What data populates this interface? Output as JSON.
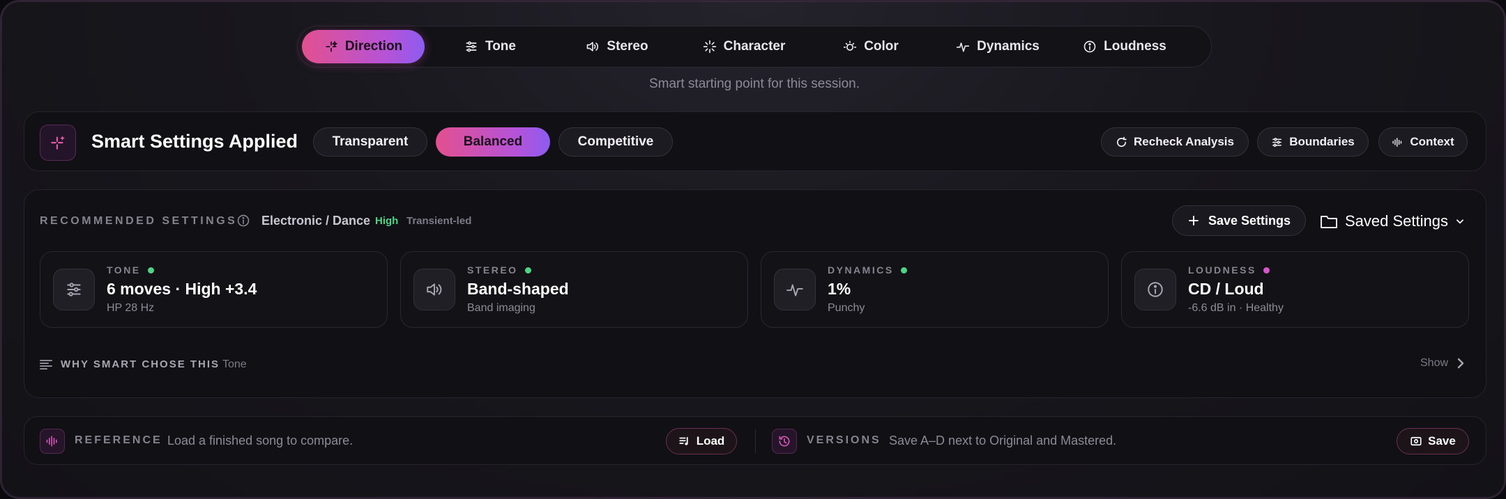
{
  "tabs": [
    {
      "label": "Direction",
      "icon": "sparkle-icon",
      "active": true
    },
    {
      "label": "Tone",
      "icon": "sliders-icon"
    },
    {
      "label": "Stereo",
      "icon": "speaker-icon"
    },
    {
      "label": "Character",
      "icon": "starburst-icon"
    },
    {
      "label": "Color",
      "icon": "sun-icon"
    },
    {
      "label": "Dynamics",
      "icon": "pulse-icon"
    },
    {
      "label": "Loudness",
      "icon": "gauge-icon"
    }
  ],
  "subtitle": "Smart starting point for this session.",
  "smart": {
    "title": "Smart Settings Applied",
    "modes": [
      "Transparent",
      "Balanced",
      "Competitive"
    ],
    "active_mode": "Balanced",
    "actions": {
      "recheck": "Recheck Analysis",
      "boundaries": "Boundaries",
      "context": "Context"
    }
  },
  "recommended": {
    "label": "RECOMMENDED SETTINGS",
    "genre": "Electronic / Dance",
    "confidence": "High",
    "character": "Transient-led",
    "save_label": "Save Settings",
    "saved_label": "Saved Settings",
    "cards": [
      {
        "category": "TONE",
        "value": "6 moves · High +3.4",
        "sub": "HP 28 Hz",
        "dot": "#4fd486",
        "icon": "sliders-icon"
      },
      {
        "category": "STEREO",
        "value": "Band-shaped",
        "sub": "Band imaging",
        "dot": "#4fd486",
        "icon": "speaker-icon"
      },
      {
        "category": "DYNAMICS",
        "value": "1%",
        "sub": "Punchy",
        "dot": "#4fd486",
        "icon": "pulse-icon"
      },
      {
        "category": "LOUDNESS",
        "value": "CD / Loud",
        "sub": "-6.6 dB in · Healthy",
        "dot": "#d755c8",
        "icon": "gauge-icon"
      }
    ],
    "why": {
      "label": "WHY SMART CHOSE THIS",
      "tag": "Tone",
      "show": "Show"
    }
  },
  "bottom": {
    "reference": {
      "label": "REFERENCE",
      "text": "Load a finished song to compare.",
      "button": "Load"
    },
    "versions": {
      "label": "VERSIONS",
      "text": "Save A–D next to Original and Mastered.",
      "button": "Save"
    }
  },
  "colors": {
    "accent_start": "#e3508f",
    "accent_end": "#8d5cf0",
    "status_green": "#4fd486",
    "status_pink": "#d755c8"
  }
}
